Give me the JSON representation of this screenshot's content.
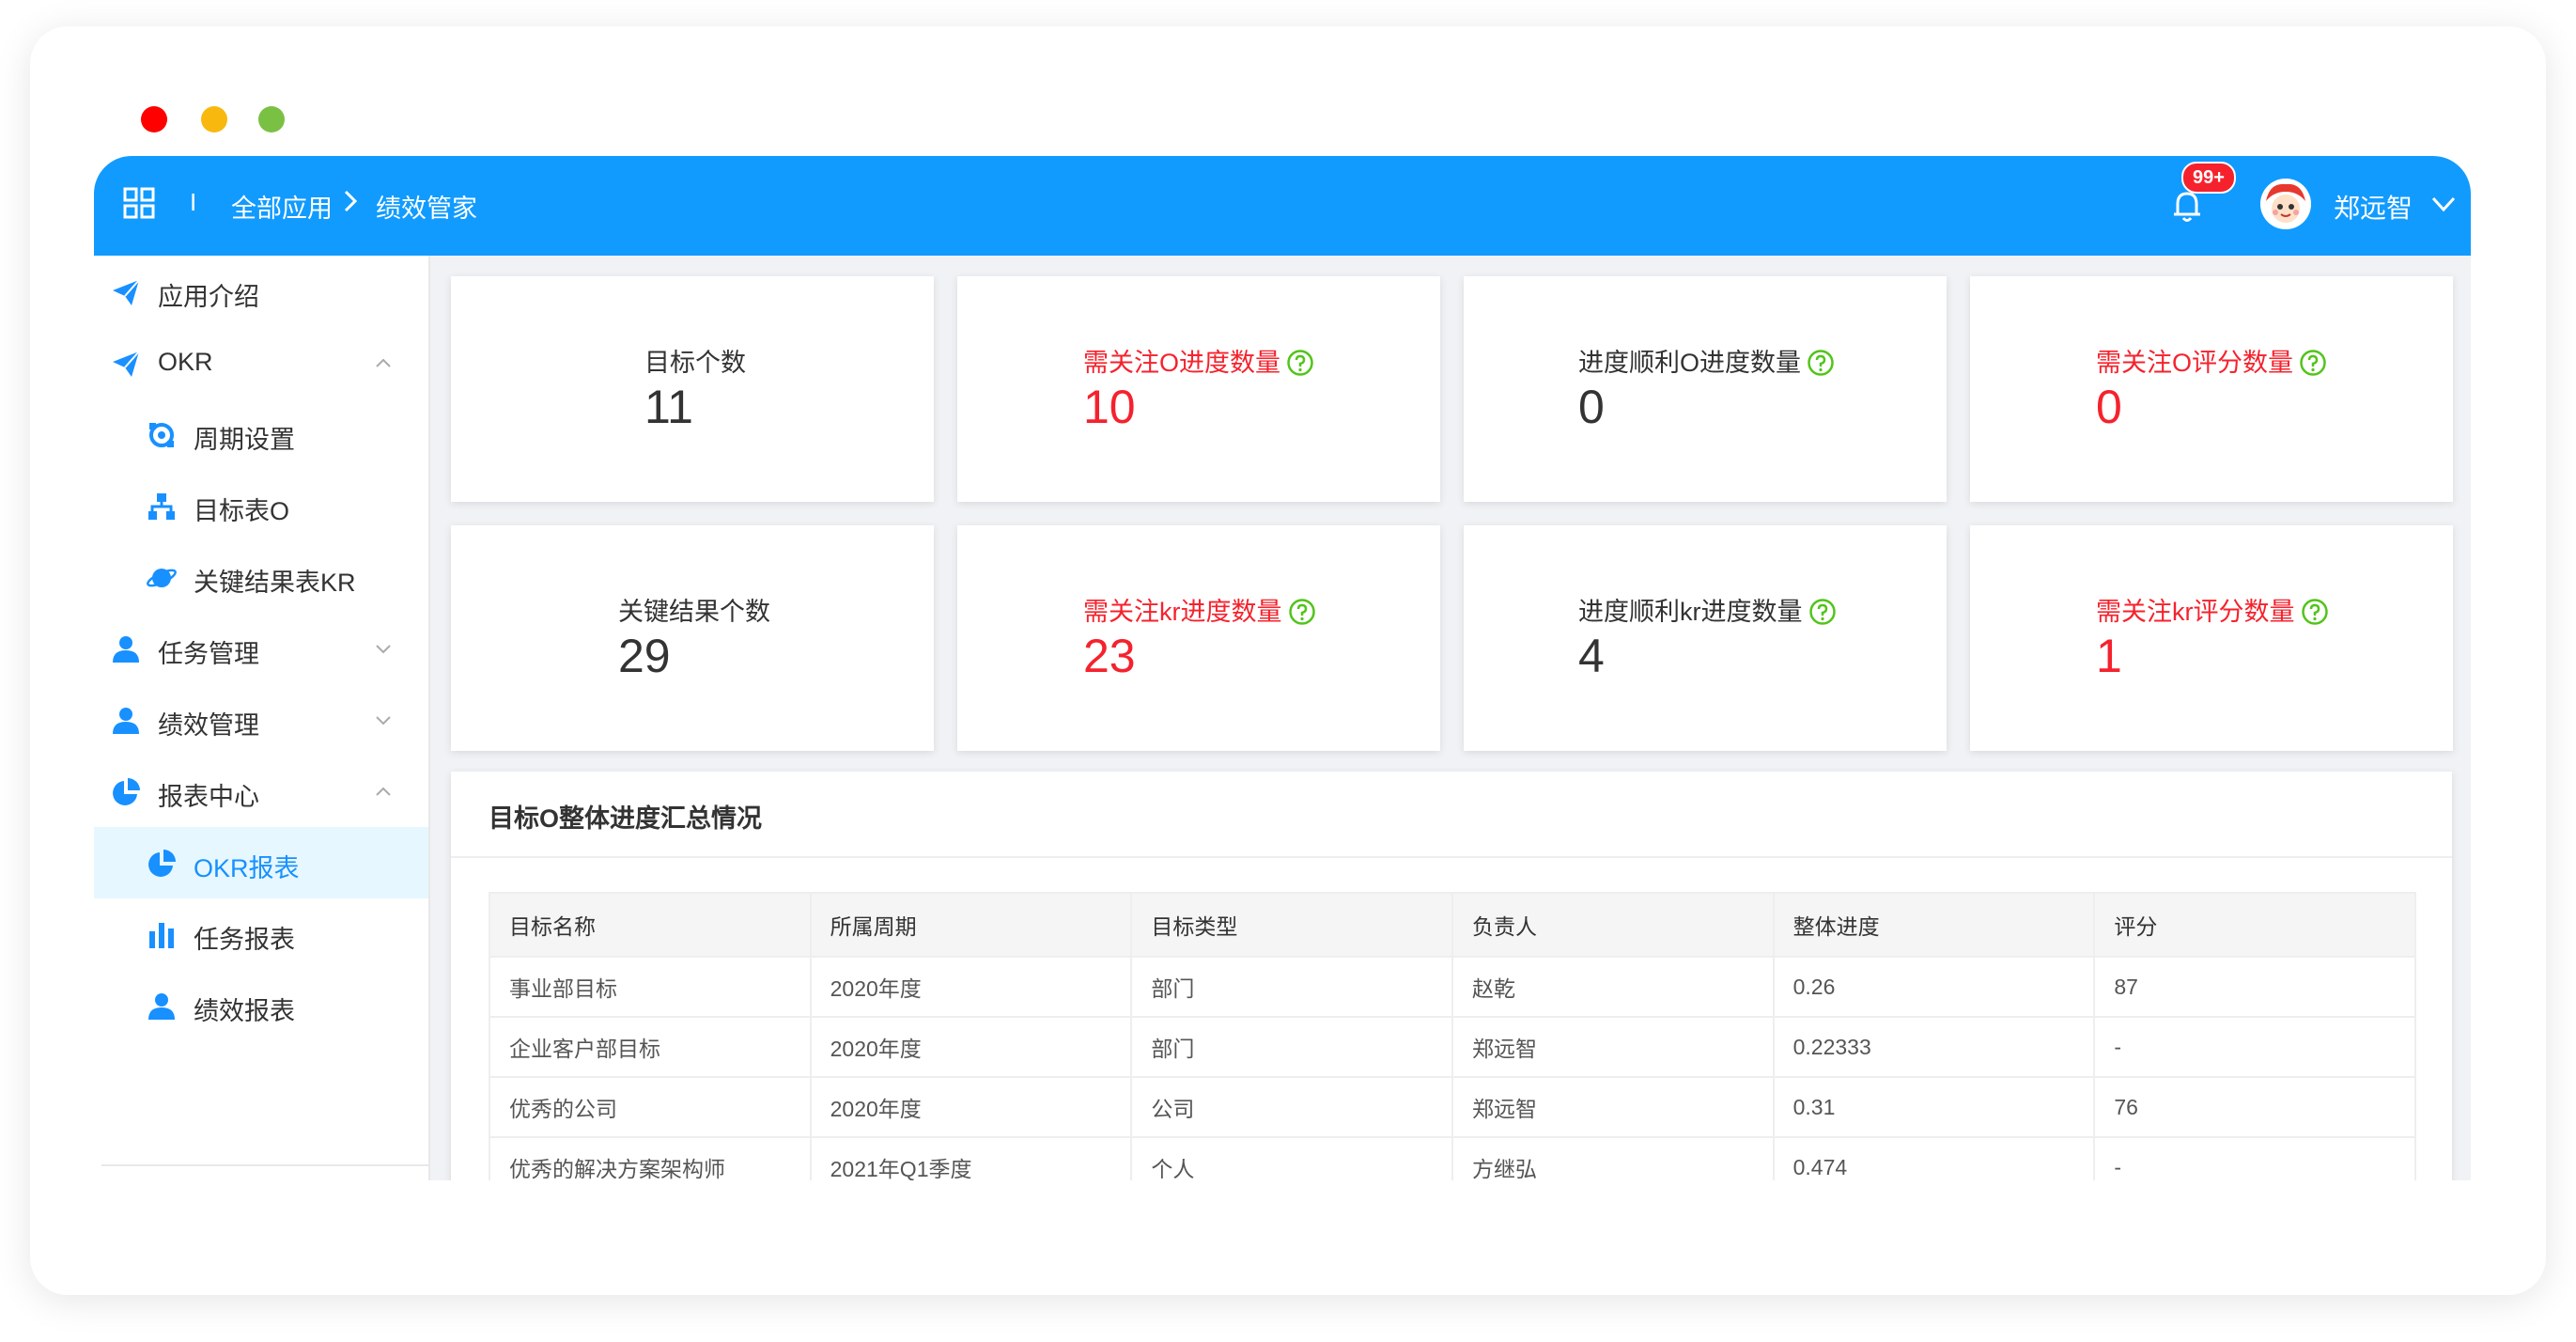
{
  "header": {
    "breadcrumb_separator": "I",
    "breadcrumb_root": "全部应用",
    "breadcrumb_current": "绩效管家",
    "notification_badge": "99+",
    "username": "郑远智",
    "brand_color": "#119bff"
  },
  "sidebar": {
    "items": [
      {
        "label": "应用介绍",
        "icon": "send-icon"
      },
      {
        "label": "OKR",
        "icon": "send-icon"
      },
      {
        "label": "周期设置",
        "icon": "cycle-icon"
      },
      {
        "label": "目标表O",
        "icon": "org-tree-icon"
      },
      {
        "label": "关键结果表KR",
        "icon": "planet-icon"
      },
      {
        "label": "任务管理",
        "icon": "user-icon"
      },
      {
        "label": "绩效管理",
        "icon": "user-icon"
      },
      {
        "label": "报表中心",
        "icon": "pie-icon"
      },
      {
        "label": "OKR报表",
        "icon": "pie-icon"
      },
      {
        "label": "任务报表",
        "icon": "bar-chart-icon"
      },
      {
        "label": "绩效报表",
        "icon": "user-icon"
      }
    ],
    "active_item": "OKR报表"
  },
  "stats": [
    {
      "label": "目标个数",
      "value": "11",
      "highlight": false
    },
    {
      "label": "需关注O进度数量",
      "value": "10",
      "highlight": true
    },
    {
      "label": "进度顺利O进度数量",
      "value": "0",
      "highlight": false
    },
    {
      "label": "需关注O评分数量",
      "value": "0",
      "highlight": true
    },
    {
      "label": "关键结果个数",
      "value": "29",
      "highlight": false
    },
    {
      "label": "需关注kr进度数量",
      "value": "23",
      "highlight": true
    },
    {
      "label": "进度顺利kr进度数量",
      "value": "4",
      "highlight": false
    },
    {
      "label": "需关注kr评分数量",
      "value": "1",
      "highlight": true
    }
  ],
  "summary": {
    "title": "目标O整体进度汇总情况",
    "columns": [
      "目标名称",
      "所属周期",
      "目标类型",
      "负责人",
      "整体进度",
      "评分"
    ],
    "rows": [
      [
        "事业部目标",
        "2020年度",
        "部门",
        "赵乾",
        "0.26",
        "87"
      ],
      [
        "企业客户部目标",
        "2020年度",
        "部门",
        "郑远智",
        "0.22333",
        "-"
      ],
      [
        "优秀的公司",
        "2020年度",
        "公司",
        "郑远智",
        "0.31",
        "76"
      ],
      [
        "优秀的解决方案架构师",
        "2021年Q1季度",
        "个人",
        "方继弘",
        "0.474",
        "-"
      ]
    ]
  }
}
